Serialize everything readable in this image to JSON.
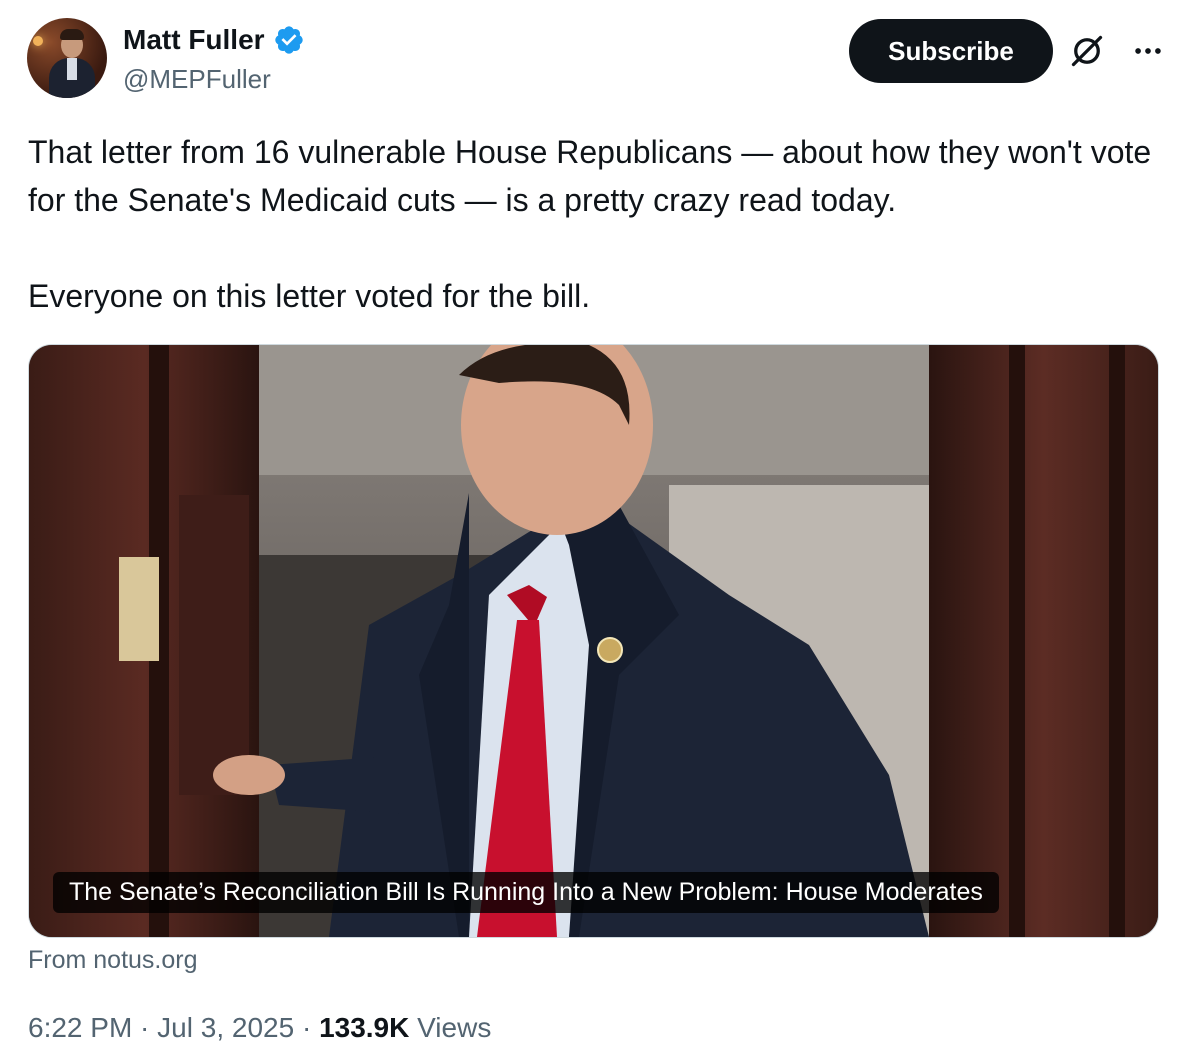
{
  "author": {
    "name": "Matt Fuller",
    "handle": "@MEPFuller",
    "verified_color": "#1d9bf0"
  },
  "actions": {
    "subscribe_label": "Subscribe",
    "grok_icon": "grok-icon",
    "more_icon": "more-icon"
  },
  "tweet": {
    "paragraph_1": "That letter from 16 vulnerable House Republicans — about how they won't vote for the Senate's Medicaid cuts — is a pretty crazy read today.",
    "paragraph_2": "Everyone on this letter voted for the bill."
  },
  "card": {
    "headline": "The Senate’s Reconciliation Bill Is Running Into a New Problem: House Moderates",
    "source": "From notus.org"
  },
  "meta": {
    "time": "6:22 PM",
    "separator": " · ",
    "date": "Jul 3, 2025",
    "views_count": "133.9K",
    "views_label": "Views"
  },
  "colors": {
    "text": "#0f1419",
    "secondary": "#536471",
    "button_bg": "#0f1419",
    "tie": "#c8102e"
  }
}
